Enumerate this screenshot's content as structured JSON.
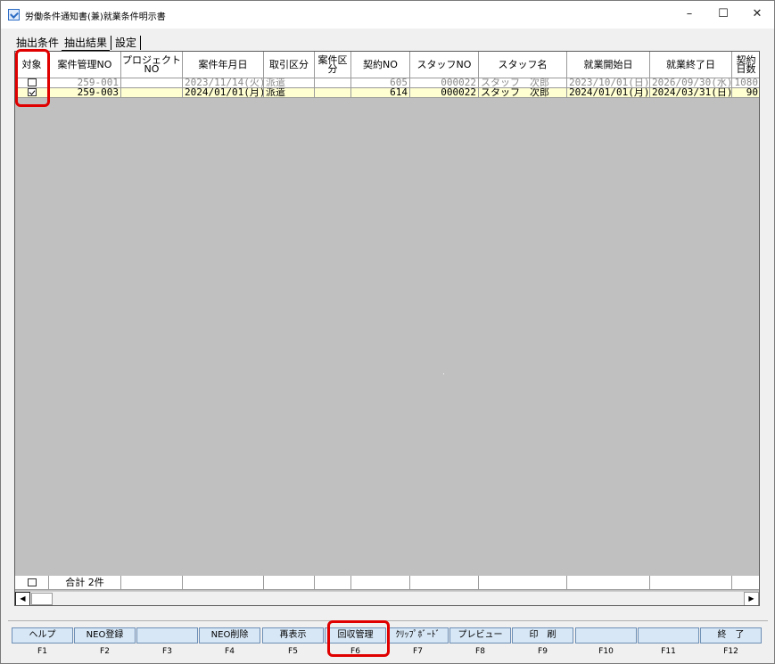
{
  "window": {
    "title": "労働条件通知書(兼)就業条件明示書",
    "minimize": "–",
    "maximize": "☐",
    "close": "✕"
  },
  "tabs": [
    {
      "label": "抽出条件"
    },
    {
      "label": "抽出結果"
    },
    {
      "label": "設定"
    }
  ],
  "grid": {
    "headers": [
      "対象",
      "案件管理NO",
      "プロジェクトNO",
      "案件年月日",
      "取引区分",
      "案件区分",
      "契約NO",
      "スタッフNO",
      "スタッフ名",
      "就業開始日",
      "就業終了日",
      "契約日数"
    ],
    "rows": [
      {
        "checked": false,
        "case_no": "259-001",
        "project_no": "",
        "case_date": "2023/11/14(火)",
        "trade_type": "派遣",
        "case_type": "",
        "contract_no": "605",
        "staff_no": "000022",
        "staff_name": "スタッフ　次郎",
        "start_date": "2023/10/01(日)",
        "end_date": "2026/09/30(水)",
        "days": "1080"
      },
      {
        "checked": true,
        "case_no": "259-003",
        "project_no": "",
        "case_date": "2024/01/01(月)",
        "trade_type": "派遣",
        "case_type": "",
        "contract_no": "614",
        "staff_no": "000022",
        "staff_name": "スタッフ　次郎",
        "start_date": "2024/01/01(月)",
        "end_date": "2024/03/31(日)",
        "days": "90"
      }
    ],
    "footer_total": "合計 2件"
  },
  "fkeys": [
    {
      "label": "ヘルプ",
      "key": "F1"
    },
    {
      "label": "NEO登録",
      "key": "F2"
    },
    {
      "label": "",
      "key": "F3"
    },
    {
      "label": "NEO削除",
      "key": "F4"
    },
    {
      "label": "再表示",
      "key": "F5"
    },
    {
      "label": "回収管理",
      "key": "F6"
    },
    {
      "label": "ｸﾘｯﾌﾟﾎﾞｰﾄﾞ",
      "key": "F7"
    },
    {
      "label": "プレビュー",
      "key": "F8"
    },
    {
      "label": "印　刷",
      "key": "F9"
    },
    {
      "label": "",
      "key": "F10"
    },
    {
      "label": "",
      "key": "F11"
    },
    {
      "label": "終　了",
      "key": "F12"
    }
  ],
  "colors": {
    "selected_row": "#ffffd2",
    "grid_bg": "#c0c0c0",
    "fkey_bg": "#d7e7f6",
    "highlight": "#e00000"
  }
}
